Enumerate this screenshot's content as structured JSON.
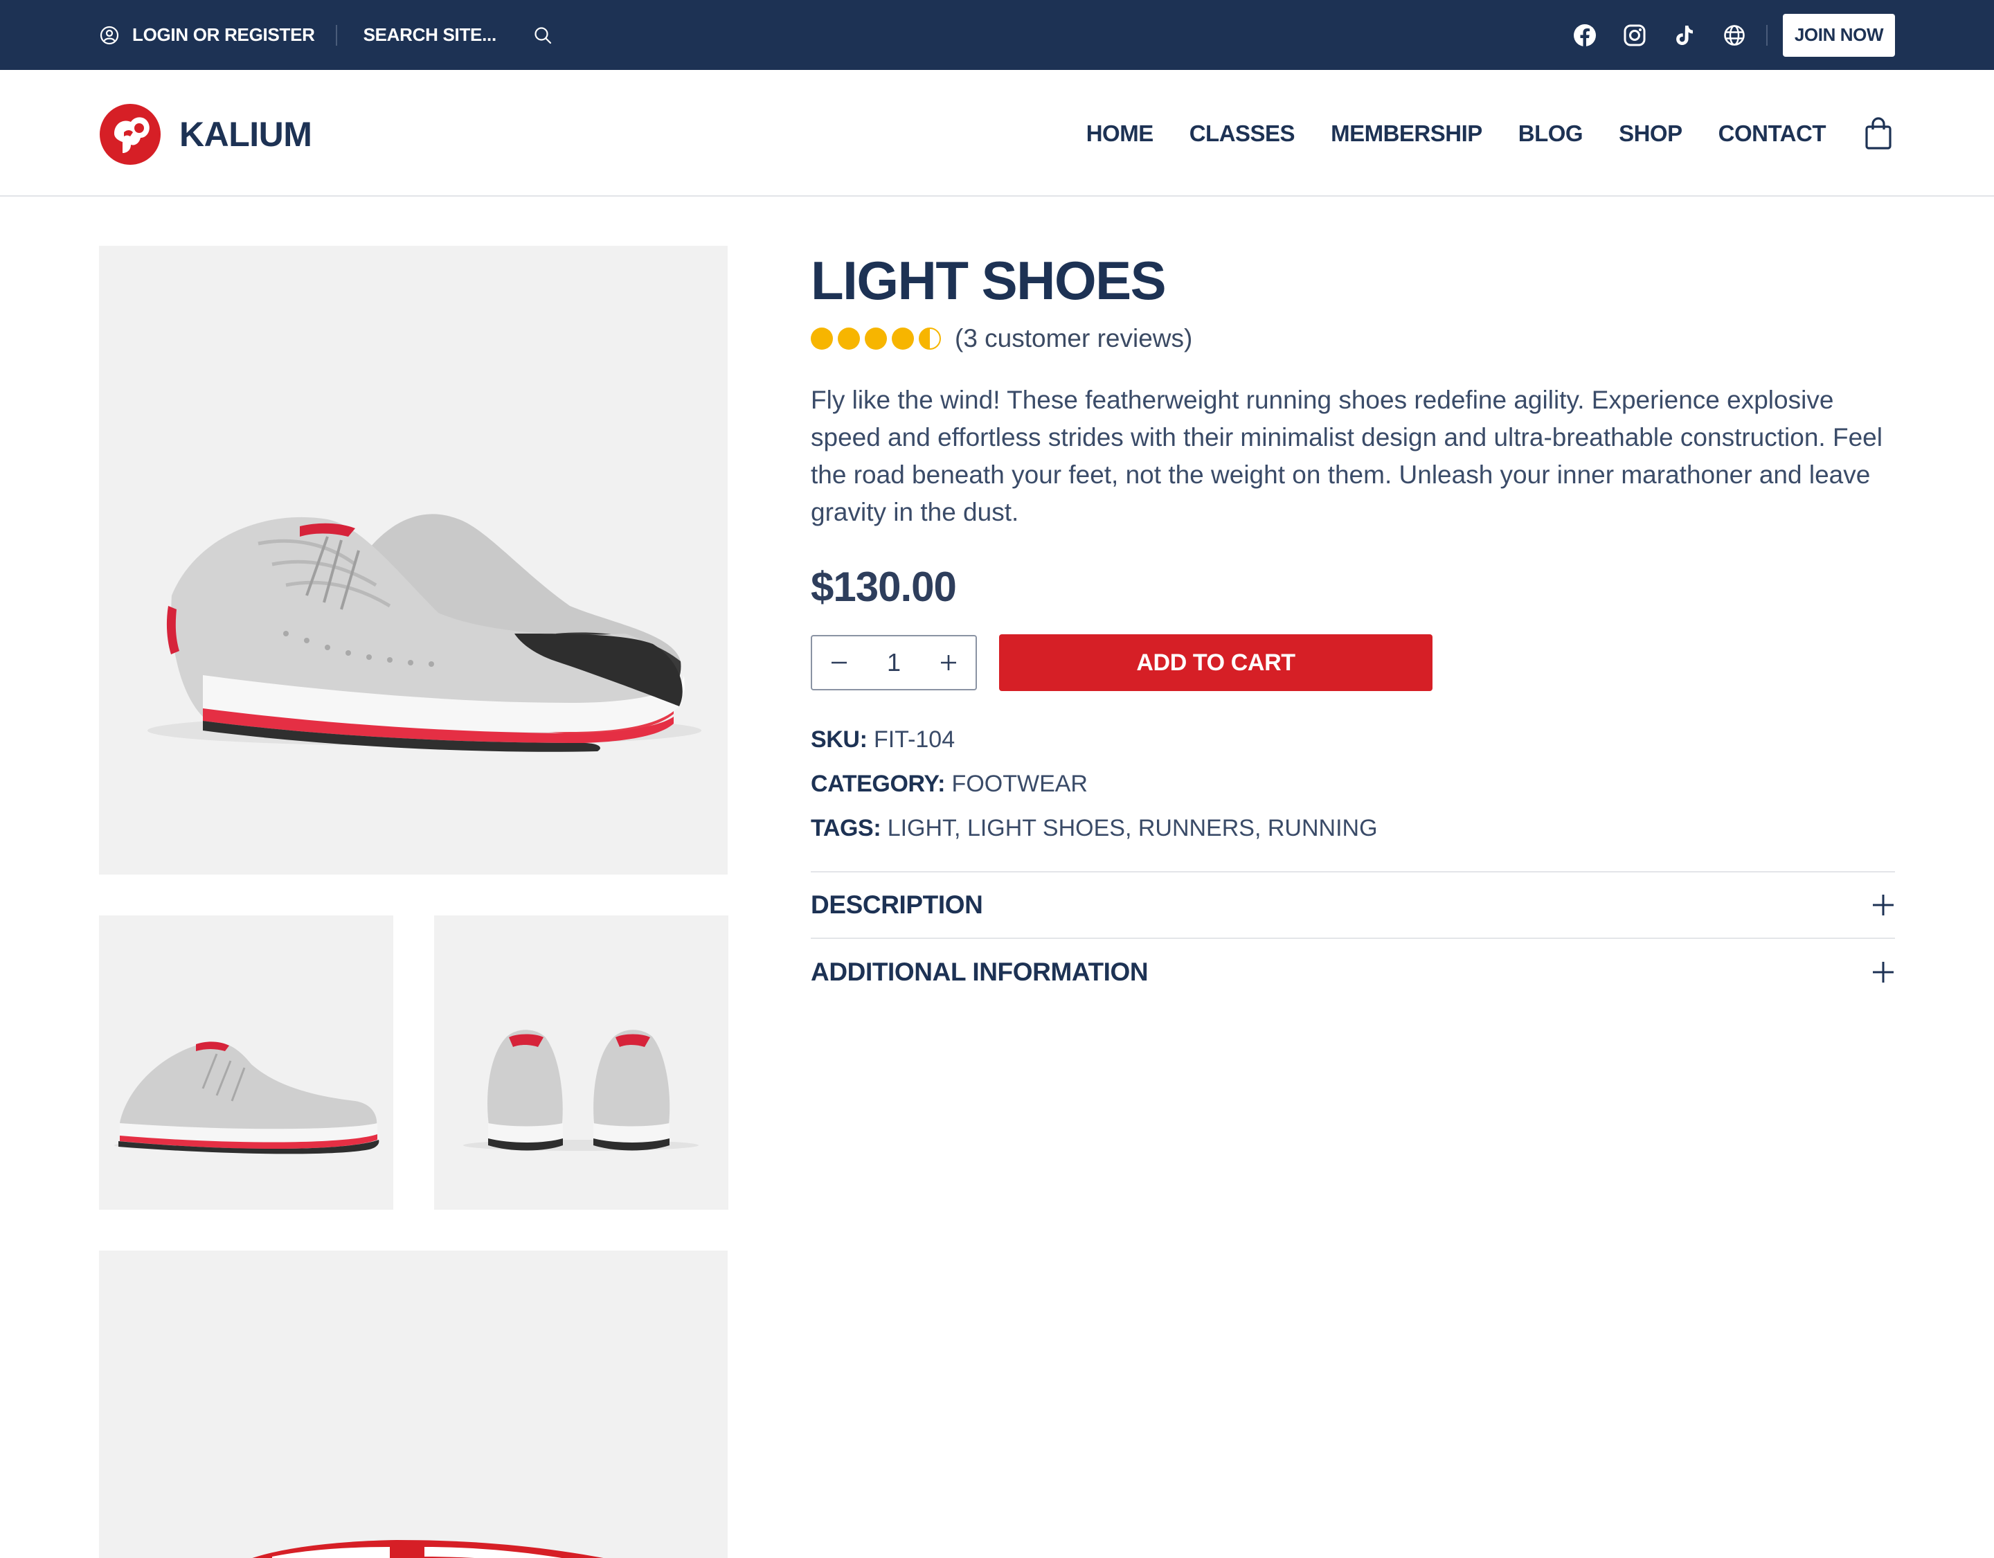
{
  "topbar": {
    "login_label": "LOGIN OR REGISTER",
    "search_placeholder": "SEARCH SITE...",
    "social": [
      "facebook-icon",
      "instagram-icon",
      "tiktok-icon",
      "globe-icon"
    ],
    "join_label": "JOIN NOW"
  },
  "header": {
    "logo_text": "KALIUM",
    "nav": [
      "HOME",
      "CLASSES",
      "MEMBERSHIP",
      "BLOG",
      "SHOP",
      "CONTACT"
    ]
  },
  "product": {
    "title": "LIGHT SHOES",
    "rating": 4.5,
    "reviews_label": "(3 customer reviews)",
    "description": "Fly like the wind! These featherweight running shoes redefine agility. Experience explosive speed and effortless strides with their minimalist design and ultra-breathable construction. Feel the road beneath your feet, not the weight on them. Unleash your inner marathoner and leave gravity in the dust.",
    "price": "$130.00",
    "quantity": "1",
    "add_to_cart_label": "ADD TO CART",
    "sku_label": "SKU:",
    "sku": "FIT-104",
    "category_label": "CATEGORY:",
    "category": "FOOTWEAR",
    "tags_label": "TAGS:",
    "tags": "LIGHT, LIGHT SHOES, RUNNERS, RUNNING"
  },
  "accordions": [
    "DESCRIPTION",
    "ADDITIONAL INFORMATION"
  ],
  "colors": {
    "navy": "#1d3254",
    "red": "#d61f26",
    "star": "#f7b500",
    "image_bg": "#f1f1f1"
  }
}
